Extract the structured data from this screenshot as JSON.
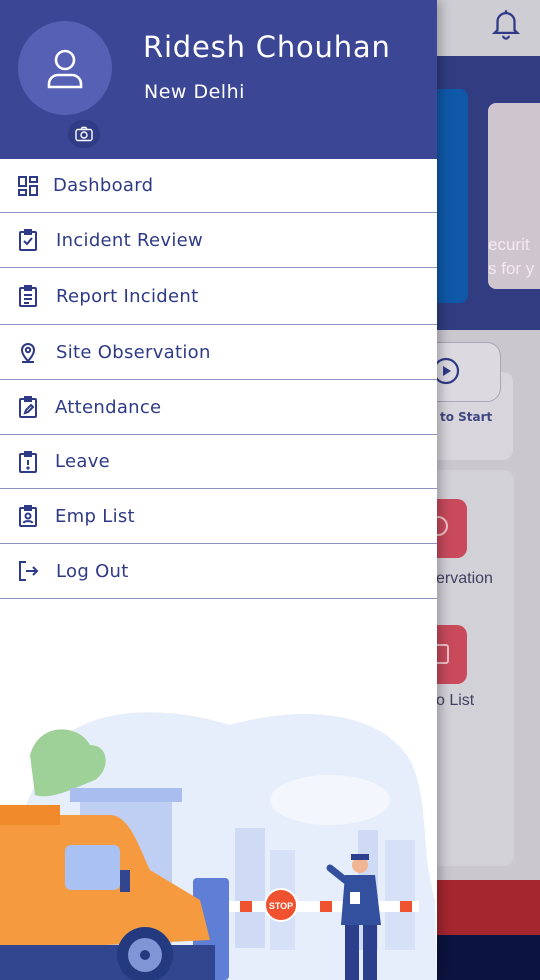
{
  "header": {
    "user_name": "Ridesh Chouhan",
    "location": "New Delhi"
  },
  "menu": {
    "items": [
      {
        "label": "Dashboard",
        "icon": "dashboard-icon"
      },
      {
        "label": "Incident Review",
        "icon": "clipboard-check-icon"
      },
      {
        "label": "Report Incident",
        "icon": "clipboard-list-icon"
      },
      {
        "label": "Site Observation",
        "icon": "location-pin-icon"
      },
      {
        "label": "Attendance",
        "icon": "clipboard-edit-icon"
      },
      {
        "label": "Leave",
        "icon": "clipboard-alert-icon"
      },
      {
        "label": "Emp List",
        "icon": "clipboard-user-icon"
      },
      {
        "label": "Log Out",
        "icon": "logout-icon"
      }
    ]
  },
  "background": {
    "card_text": "ecurit\ns for y",
    "start_label": "to Start",
    "observation_label": "ervation",
    "list_label": "o List"
  },
  "illustration": {
    "stop_sign": "STOP"
  },
  "colors": {
    "header_bg": "#3b4694",
    "menu_text": "#2f3a86",
    "divider": "#8d92be",
    "accent_red": "#c84a5b"
  }
}
